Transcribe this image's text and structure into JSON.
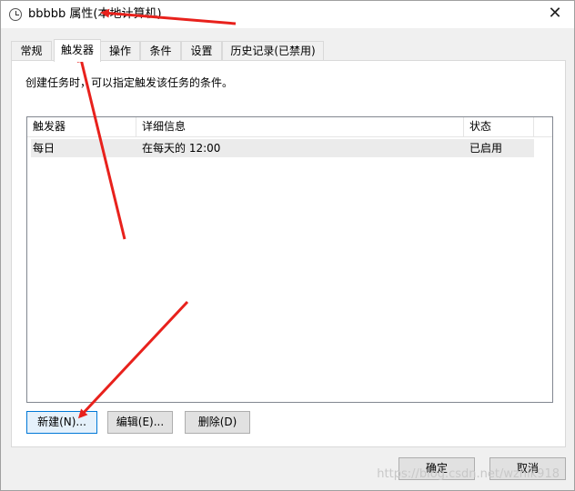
{
  "window": {
    "title": "bbbbb 属性(本地计算机)",
    "close_glyph": "✕"
  },
  "tabs": [
    {
      "label": "常规",
      "active": false
    },
    {
      "label": "触发器",
      "active": true
    },
    {
      "label": "操作",
      "active": false
    },
    {
      "label": "条件",
      "active": false
    },
    {
      "label": "设置",
      "active": false
    },
    {
      "label": "历史记录(已禁用)",
      "active": false
    }
  ],
  "panel": {
    "description": "创建任务时，可以指定触发该任务的条件。"
  },
  "trigger_list": {
    "columns": [
      "触发器",
      "详细信息",
      "状态"
    ],
    "rows": [
      {
        "trigger": "每日",
        "details": "在每天的 12:00",
        "status": "已启用"
      }
    ]
  },
  "buttons": {
    "new": "新建(N)...",
    "edit": "编辑(E)...",
    "delete": "删除(D)",
    "ok": "确定",
    "cancel": "取消"
  },
  "watermark": "https://blog.csdn.net/wzhlk918",
  "colors": {
    "annotation_arrow": "#e8211c",
    "focus_border": "#0078d7",
    "selected_row": "#ebebeb"
  }
}
